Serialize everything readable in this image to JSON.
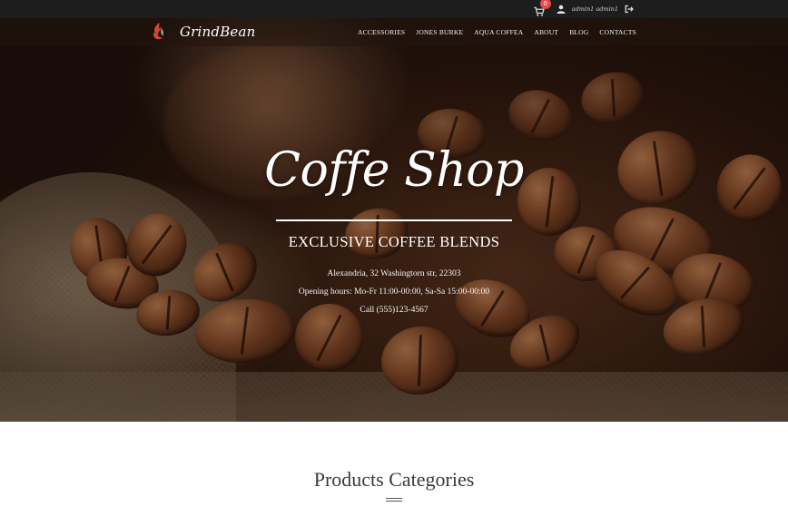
{
  "topbar": {
    "cart_count": "0",
    "user_name": "admin1 admin1"
  },
  "brand": {
    "name": "GrindBean"
  },
  "nav": {
    "items": [
      {
        "label": "ACCESSORIES"
      },
      {
        "label": "JONES BURKE"
      },
      {
        "label": "AQUA COFFEA"
      },
      {
        "label": "ABOUT"
      },
      {
        "label": "BLOG"
      },
      {
        "label": "CONTACTS"
      }
    ]
  },
  "hero": {
    "title": "Coffe Shop",
    "subtitle": "EXCLUSIVE COFFEE BLENDS",
    "address": "Alexandria, 32 Washingtorn str, 22303",
    "hours": "Opening hours: Mo-Fr 11:00-00:00, Sa-Sa 15:00-00:00",
    "phone": "Call (555)123-4567"
  },
  "categories": {
    "title": "Products Categories"
  },
  "colors": {
    "topbar_bg": "#1d1d1d",
    "badge": "#e74a4a",
    "logo_accent": "#d9443a"
  }
}
